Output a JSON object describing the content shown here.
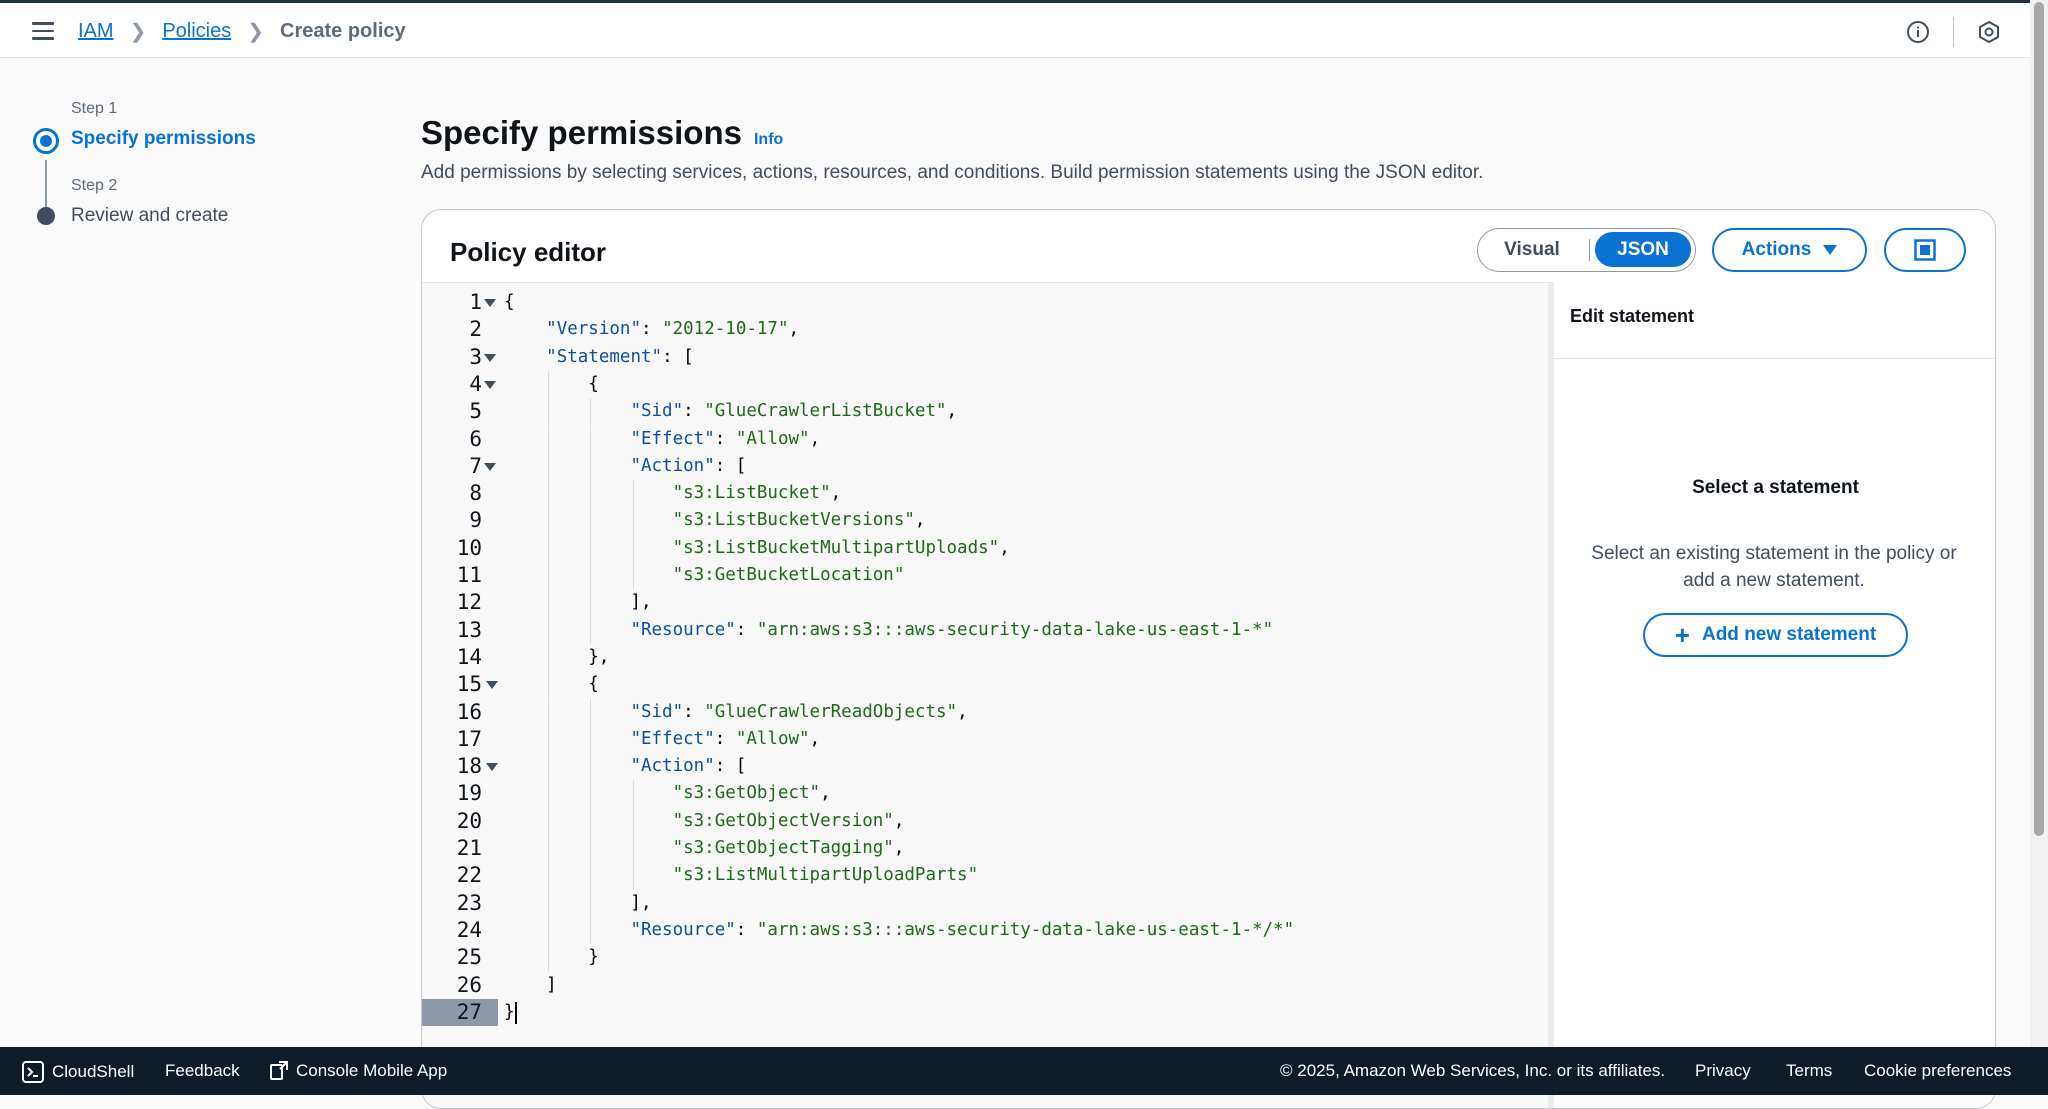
{
  "breadcrumb": {
    "items": [
      "IAM",
      "Policies"
    ],
    "current": "Create policy"
  },
  "steps": [
    {
      "label": "Step 1",
      "title": "Specify permissions"
    },
    {
      "label": "Step 2",
      "title": "Review and create"
    }
  ],
  "page": {
    "title": "Specify permissions",
    "info": "Info",
    "description": "Add permissions by selecting services, actions, resources, and conditions. Build permission statements using the JSON editor."
  },
  "editor": {
    "title": "Policy editor",
    "toggle": {
      "visual": "Visual",
      "json": "JSON",
      "selected": "JSON"
    },
    "actions_label": "Actions",
    "code_lines": [
      "{",
      "    \"Version\": \"2012-10-17\",",
      "    \"Statement\": [",
      "        {",
      "            \"Sid\": \"GlueCrawlerListBucket\",",
      "            \"Effect\": \"Allow\",",
      "            \"Action\": [",
      "                \"s3:ListBucket\",",
      "                \"s3:ListBucketVersions\",",
      "                \"s3:ListBucketMultipartUploads\",",
      "                \"s3:GetBucketLocation\"",
      "            ],",
      "            \"Resource\": \"arn:aws:s3:::aws-security-data-lake-us-east-1-*\"",
      "        },",
      "        {",
      "            \"Sid\": \"GlueCrawlerReadObjects\",",
      "            \"Effect\": \"Allow\",",
      "            \"Action\": [",
      "                \"s3:GetObject\",",
      "                \"s3:GetObjectVersion\",",
      "                \"s3:GetObjectTagging\",",
      "                \"s3:ListMultipartUploadParts\"",
      "            ],",
      "            \"Resource\": \"arn:aws:s3:::aws-security-data-lake-us-east-1-*/*\"",
      "        }",
      "    ]",
      "}"
    ],
    "fold_lines": [
      1,
      3,
      4,
      7,
      15,
      18
    ],
    "active_line": 27
  },
  "side_panel": {
    "title": "Edit statement",
    "select_heading": "Select a statement",
    "select_desc": "Select an existing statement in the policy or add a new statement.",
    "add_button": "Add new statement"
  },
  "footer": {
    "cloudshell": "CloudShell",
    "feedback": "Feedback",
    "mobile_app": "Console Mobile App",
    "copyright": "© 2025, Amazon Web Services, Inc. or its affiliates.",
    "privacy": "Privacy",
    "terms": "Terms",
    "cookies": "Cookie preferences"
  },
  "colors": {
    "accent": "#0972d3",
    "footer_bg": "#0f1b2a",
    "json_key": "#0b4f9e",
    "json_string": "#1e6a18"
  }
}
